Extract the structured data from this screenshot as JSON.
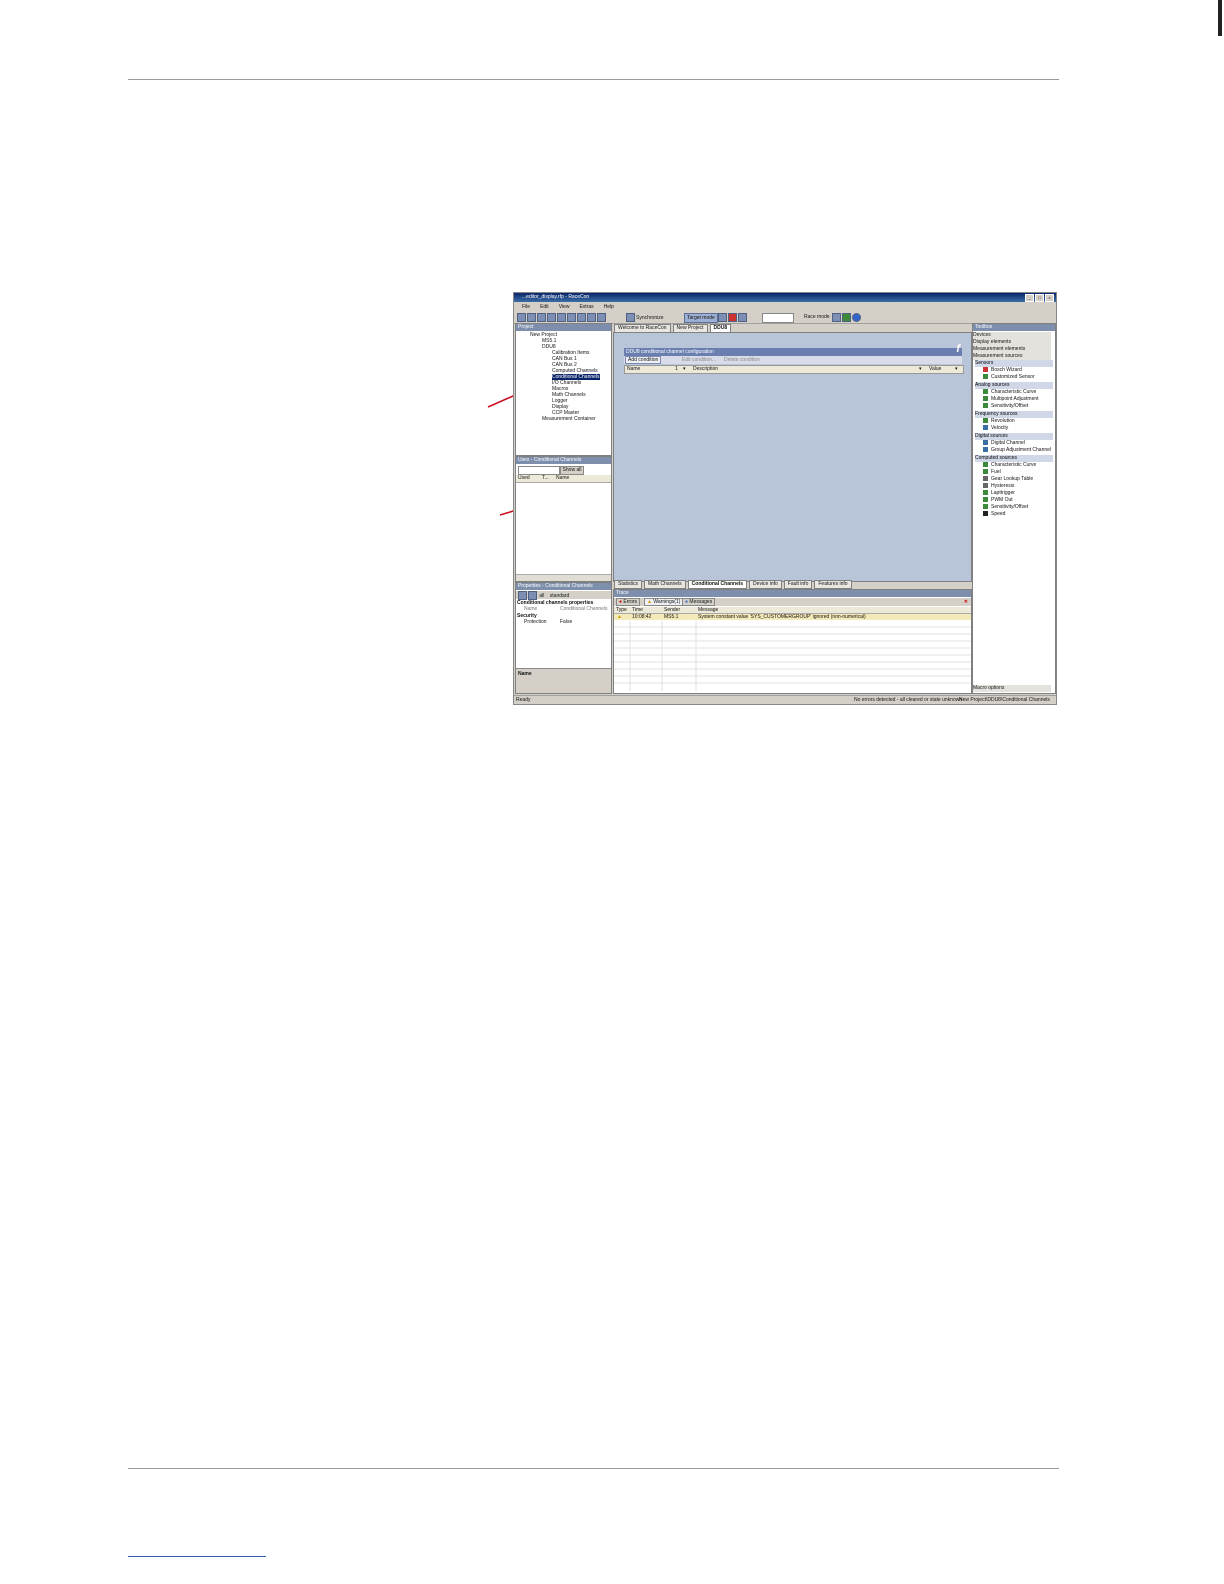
{
  "window": {
    "title": "...editor_display.rfp - RaceCon"
  },
  "menu": [
    "File",
    "Edit",
    "View",
    "Extras",
    "Help"
  ],
  "toolbar": {
    "synchronize": "Synchronize",
    "target_mode": "Target mode",
    "race_mode": "Race mode"
  },
  "project_panel": {
    "title": "Project",
    "items": [
      "New Project",
      "MS5.1",
      "DDU8",
      "Calibration Items",
      "CAN Bus 1",
      "CAN Bus 2",
      "Computed Channels",
      "Conditional Channels",
      "I/O Channels",
      "Macros",
      "Math Channels",
      "Logger",
      "Display",
      "CCP Master",
      "Measurement Container"
    ]
  },
  "used_panel": {
    "title": "Uses - Conditional Channels",
    "show_all": "Show all",
    "columns": [
      "Used",
      "T...",
      "Name"
    ]
  },
  "properties_panel": {
    "title": "Properties - Conditional Channels",
    "filter_all": "all",
    "filter_standard": "standard",
    "section1": "Conditional channels properties",
    "name_label": "Name",
    "name_value": "Conditional Channels",
    "section2": "Security",
    "protection_label": "Protection",
    "protection_value": "False",
    "footer_label": "Name"
  },
  "doc_tabs": [
    "Welcome to RaceCon",
    "New Project",
    "DDU8"
  ],
  "config": {
    "title": "DDU8 conditional channel configuration",
    "add": "Add condition",
    "edit": "Edit condition...",
    "delete": "Delete condition",
    "col_name": "Name",
    "col_sort": "1",
    "col_desc": "Description",
    "col_value": "Value"
  },
  "bottom_tabs": [
    "Statistics",
    "Math Channels",
    "Conditional Channels",
    "Device info",
    "Fault info",
    "Features info"
  ],
  "trace": {
    "title": "Trace",
    "errors": "Errors",
    "warnings": "Warnings(1)",
    "messages": "Messages",
    "columns": [
      "Type",
      "Time",
      "Sender",
      "Message"
    ],
    "row": {
      "time": "10:08:42",
      "sender": "MS5.1",
      "message": "System constant value 'SYS_CUSTOMERGROUP' ignored (non-numerical)"
    }
  },
  "toolbox": {
    "title": "Toolbox",
    "sections": [
      "Devices",
      "Display elements",
      "Measurement elements",
      "Measurement sources"
    ],
    "groups": [
      {
        "name": "Sensors",
        "items": [
          "Bosch Wizard",
          "Customized Sensor"
        ]
      },
      {
        "name": "Analog sources",
        "items": [
          "Characteristic Curve",
          "Multipoint Adjustment",
          "Sensitivity/Offset"
        ]
      },
      {
        "name": "Frequency sources",
        "items": [
          "Revolution",
          "Velocity"
        ]
      },
      {
        "name": "Digital sources",
        "items": [
          "Digital Channel",
          "Group Adjustment Channel"
        ]
      },
      {
        "name": "Computed sources",
        "items": [
          "Characteristic Curve",
          "Fuel",
          "Gear Lookup Table",
          "Hysteresis",
          "Lapttrigger",
          "PWM Out",
          "Sensitivity/Offset",
          "Speed"
        ]
      }
    ],
    "footer": "Macro options"
  },
  "status": {
    "left": "Ready",
    "middle": "No errors detected - all cleared or state unknown",
    "right": "New Project\\DDU8\\Conditional Channels"
  },
  "colors": {
    "annotation_arrow": "#cc1122",
    "workspace": "#b8c4d8",
    "header_blue": "#6a7fb0"
  }
}
